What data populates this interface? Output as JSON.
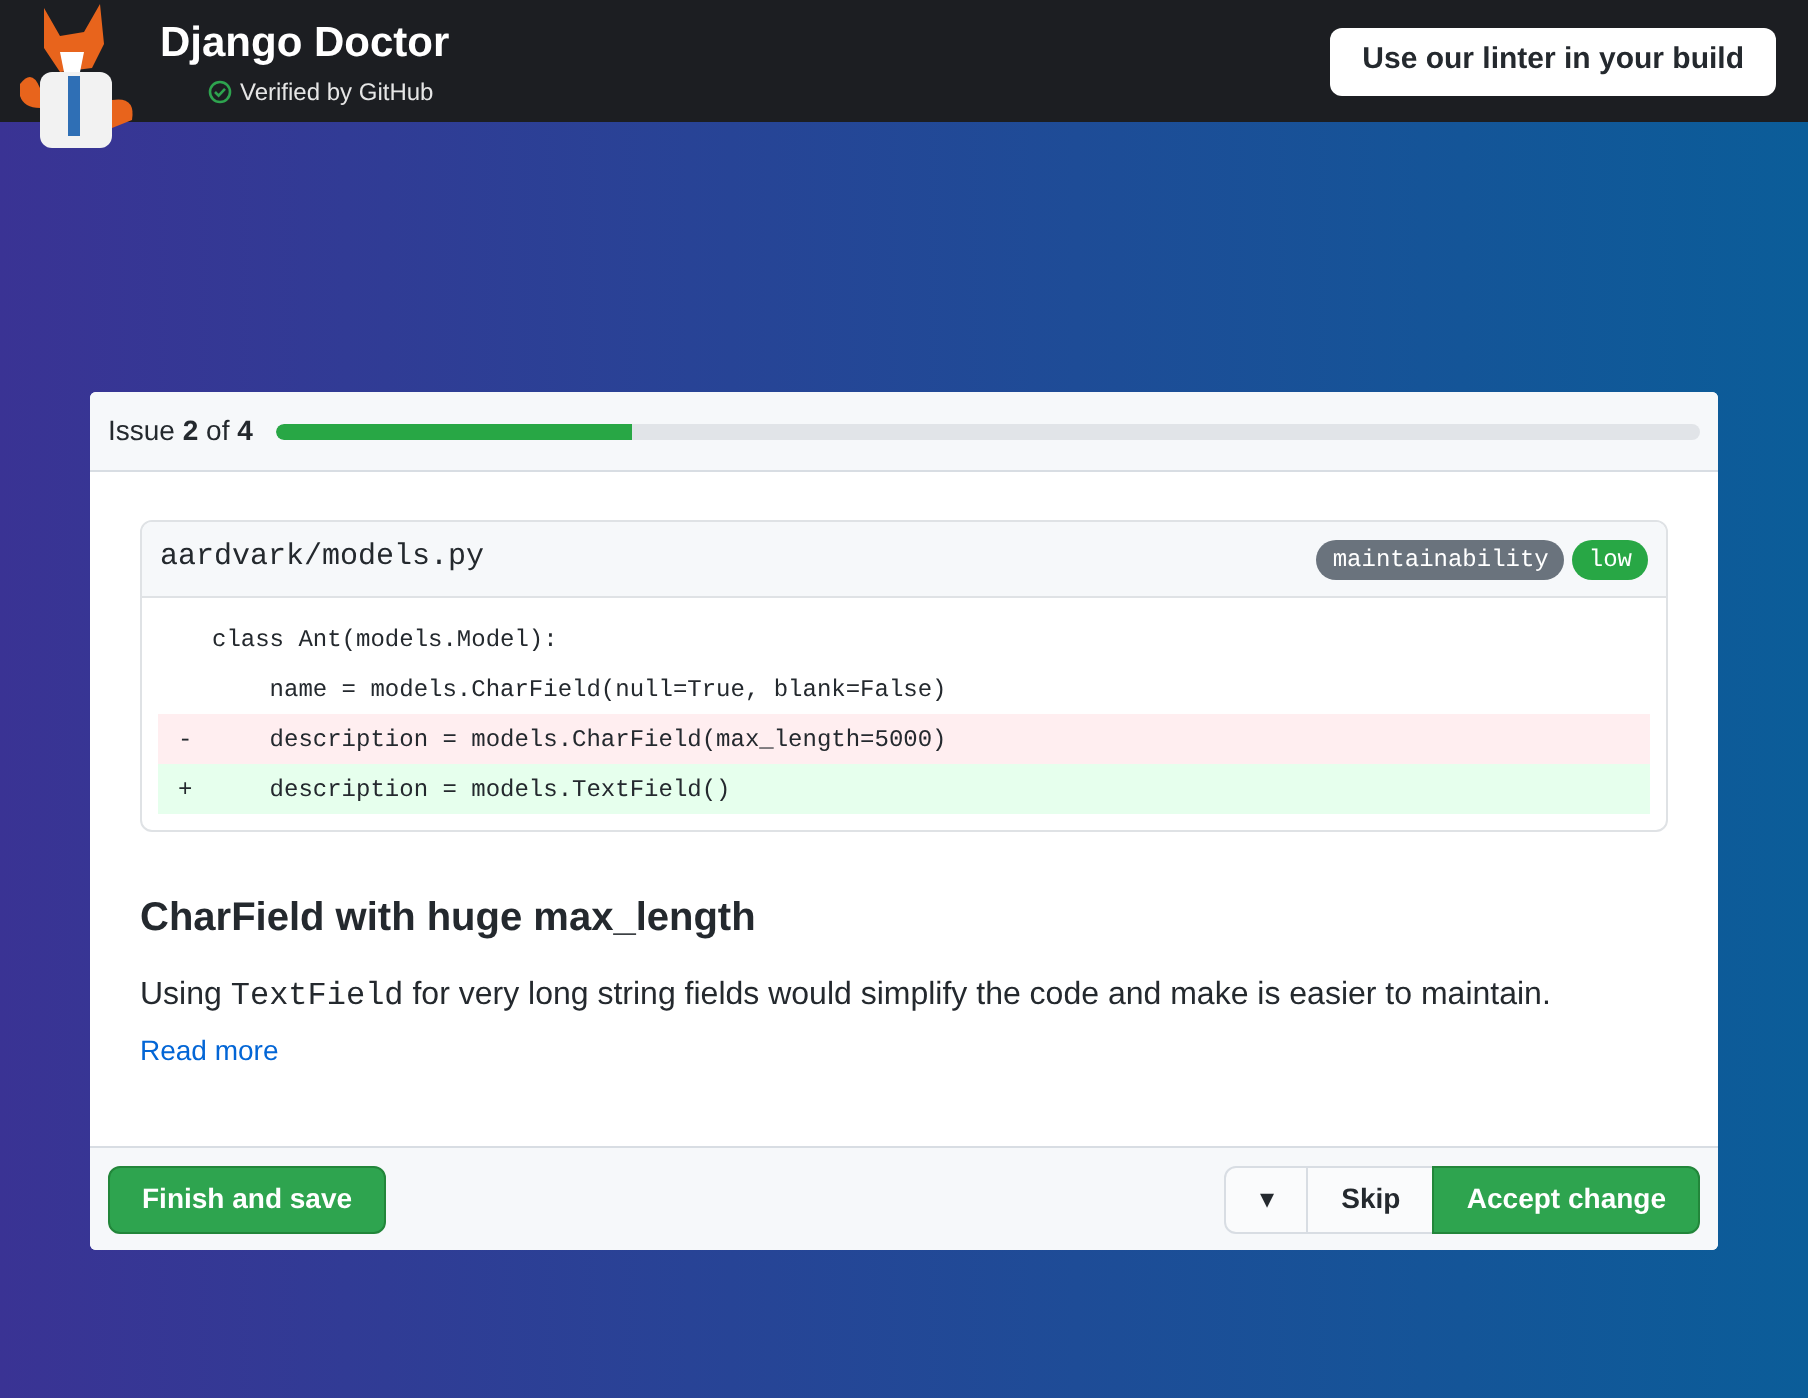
{
  "header": {
    "title": "Django Doctor",
    "verified": "Verified by GitHub",
    "cta": "Use our linter in your build"
  },
  "progress": {
    "label": "Issue **2** of **4**",
    "level": 0.25
  },
  "file": {
    "path": "aardvark/models.py",
    "tags": [
      {
        "label": "maintainability",
        "color": "#6a737d"
      },
      {
        "label": "low",
        "color": "#28a745"
      }
    ],
    "lines": [
      {
        "kind": "context",
        "code": "class Ant(models.Model):"
      },
      {
        "kind": "context",
        "code": "    name = models.CharField(null=True, blank=False)"
      },
      {
        "kind": "removed",
        "marker": "-",
        "code": "    description = models.CharField(max_length=5000)"
      },
      {
        "kind": "added",
        "marker": "+",
        "code": "    description = models.TextField()"
      }
    ]
  },
  "issue": {
    "title": "CharField with huge max_length",
    "text_before": "Using",
    "code": "TextField",
    "text_after": "for very long string fields would simplify the code and make is easier to maintain.",
    "link": "Read more"
  },
  "footer": {
    "finish": "Finish and save",
    "dropdown": "▾",
    "skip": "Skip",
    "accept": "Accept change"
  }
}
